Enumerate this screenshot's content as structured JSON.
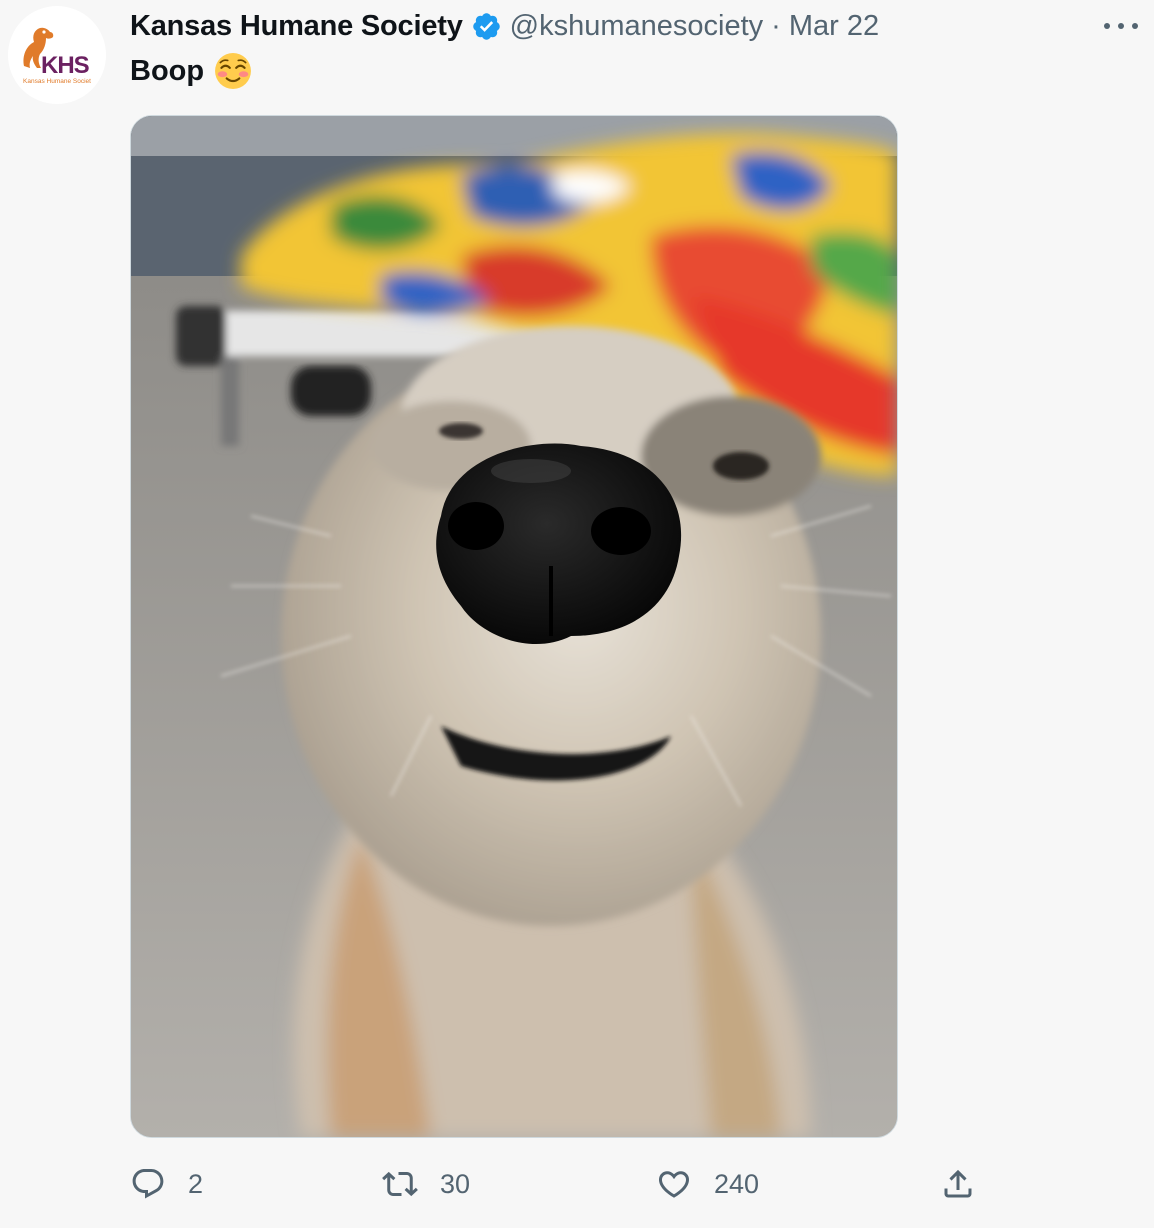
{
  "tweet": {
    "author": {
      "name": "Kansas Humane Society",
      "handle": "@kshumanesociety",
      "verified": true,
      "avatar": {
        "logo_text": "KHS",
        "logo_subtext": "Kansas Humane Societ",
        "colors": {
          "orange": "#e07b2a",
          "purple": "#6b2161"
        }
      }
    },
    "separator": "·",
    "date": "Mar 22",
    "text": "Boop",
    "emoji": "smiling-face-with-blush",
    "media": {
      "alt": "Close-up photo of a scruffy dog's nose"
    },
    "actions": {
      "reply_count": "2",
      "retweet_count": "30",
      "like_count": "240"
    }
  },
  "colors": {
    "verified_blue": "#1d9bf0",
    "secondary_text": "#536471",
    "background": "#f7f7f7"
  },
  "icons": [
    "verified-badge-icon",
    "more-options-icon",
    "reply-icon",
    "retweet-icon",
    "like-icon",
    "share-icon"
  ]
}
